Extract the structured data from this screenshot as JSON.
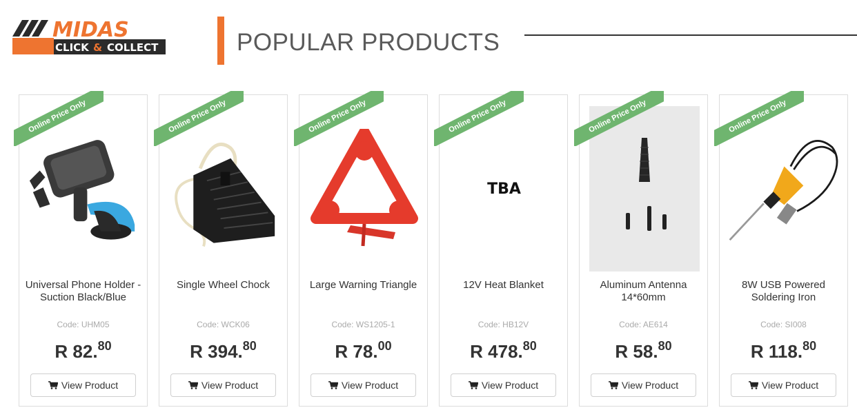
{
  "header": {
    "logo_text": "MIDAS",
    "logo_sub_left": "CLICK",
    "logo_amp": "&",
    "logo_sub_right": "COLLECT",
    "title": "POPULAR PRODUCTS"
  },
  "colors": {
    "accent_orange": "#ee7430",
    "ribbon_green": "#6fb56f"
  },
  "products": [
    {
      "ribbon": "Online Price Only",
      "name": "Universal Phone Holder - Suction Black/Blue",
      "code": "Code: UHM05",
      "price_main": "R 82.",
      "price_cents": "80",
      "button": "View Product",
      "image": "phone-holder"
    },
    {
      "ribbon": "Online Price Only",
      "name": "Single Wheel Chock",
      "code": "Code: WCK06",
      "price_main": "R 394.",
      "price_cents": "80",
      "button": "View Product",
      "image": "wheel-chock"
    },
    {
      "ribbon": "Online Price Only",
      "name": "Large Warning Triangle",
      "code": "Code: WS1205-1",
      "price_main": "R 78.",
      "price_cents": "00",
      "button": "View Product",
      "image": "warning-triangle"
    },
    {
      "ribbon": "Online Price Only",
      "name": "12V Heat Blanket",
      "code": "Code: HB12V",
      "price_main": "R 478.",
      "price_cents": "80",
      "button": "View Product",
      "image": "tba",
      "image_text": "TBA"
    },
    {
      "ribbon": "Online Price Only",
      "name": "Aluminum Antenna 14*60mm",
      "code": "Code: AE614",
      "price_main": "R 58.",
      "price_cents": "80",
      "button": "View Product",
      "image": "antenna"
    },
    {
      "ribbon": "Online Price Only",
      "name": "8W USB Powered Soldering Iron",
      "code": "Code: SI008",
      "price_main": "R 118.",
      "price_cents": "80",
      "button": "View Product",
      "image": "soldering-iron"
    }
  ]
}
